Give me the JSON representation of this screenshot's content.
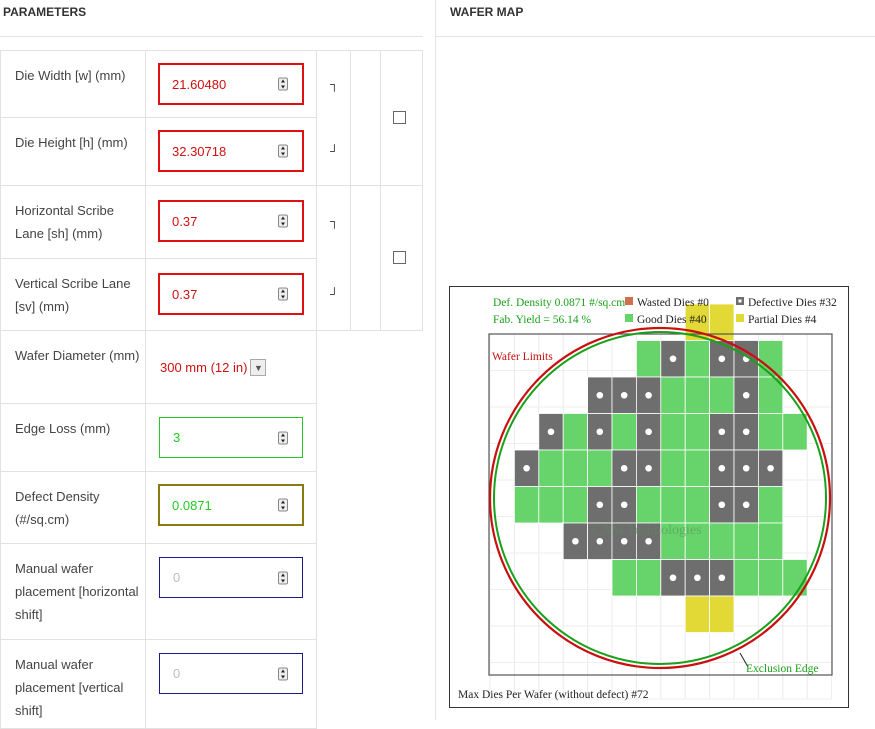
{
  "headers": {
    "parameters": "PARAMETERS",
    "wafer_map": "WAFER MAP"
  },
  "params": {
    "die_width": {
      "label": "Die Width [w] (mm)",
      "value": "21.60480"
    },
    "die_height": {
      "label": "Die Height [h] (mm)",
      "value": "32.30718"
    },
    "h_scribe": {
      "label": "Horizontal Scribe Lane [sh] (mm)",
      "value": "0.37"
    },
    "v_scribe": {
      "label": "Vertical Scribe Lane [sv] (mm)",
      "value": "0.37"
    },
    "wafer_diameter": {
      "label": "Wafer Diameter (mm)",
      "value": "300 mm (12 in)"
    },
    "edge_loss": {
      "label": "Edge Loss (mm)",
      "value": "3"
    },
    "defect_density": {
      "label": "Defect Density (#/sq.cm)",
      "value": "0.0871"
    },
    "manual_h": {
      "label": "Manual wafer placement [horizontal shift]",
      "placeholder": "0"
    },
    "manual_v": {
      "label": "Manual wafer placement [vertical shift]",
      "placeholder": "0"
    }
  },
  "brackets": {
    "top": "┐",
    "bottom": "┘"
  },
  "wafer_map": {
    "def_density": "Def. Density 0.0871 #/sq.cm",
    "fab_yield": "Fab. Yield = 56.14 %",
    "legend": {
      "wasted": "Wasted Dies  #0",
      "defective": "Defective Dies  #32",
      "good": "Good Dies #40",
      "partial": "Partial Dies #4"
    },
    "wafer_limits": "Wafer Limits",
    "exclusion_edge": "Exclusion Edge",
    "watermark": "CAM Technologies",
    "max_dies": "Max Dies Per Wafer (without defect) #72",
    "colors": {
      "good": "#66d46a",
      "defective": "#6e6e6e",
      "partial": "#e2d836",
      "wasted": "#d07050",
      "wafer_limit": "#c81010",
      "exclusion": "#1aa01a",
      "title_green": "#1aa01a"
    },
    "grid": [
      "....PP....",
      "...GDGDDG.",
      "..DDDGGGDG",
      ".DGDGDGGDDGG",
      ".DGGGDDGGDDD",
      ".GGGDDGGGDDG",
      "..DDDDGGGGG",
      "...GGDDDGGG",
      "....PP...."
    ]
  }
}
